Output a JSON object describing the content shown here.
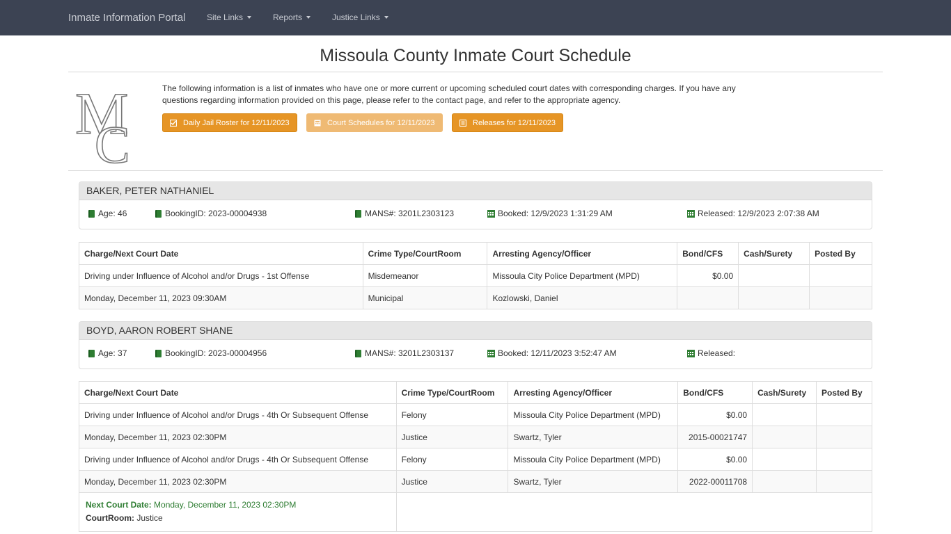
{
  "navbar": {
    "brand": "Inmate Information Portal",
    "menus": [
      "Site Links",
      "Reports",
      "Justice Links"
    ]
  },
  "page": {
    "title": "Missoula County Inmate Court Schedule",
    "intro": "The following information is a list of inmates who have one or more current or upcoming scheduled court dates with corresponding charges. If you have any questions regarding information provided on this page, please refer to the contact page, and refer to the appropriate agency.",
    "buttons": {
      "roster": "Daily Jail Roster for 12/11/2023",
      "court": "Court Schedules for 12/11/2023",
      "releases": "Releases for 12/11/2023"
    },
    "logo_text": "MC"
  },
  "columns1": [
    "Charge/Next Court Date",
    "Crime Type/CourtRoom",
    "Arresting Agency/Officer",
    "Bond/CFS",
    "Cash/Surety",
    "Posted By"
  ],
  "inmates": [
    {
      "name": "BAKER, PETER NATHANIEL",
      "age": "Age: 46",
      "booking_id": "BookingID: 2023-00004938",
      "mans": "MANS#: 3201L2303123",
      "booked": "Booked: 12/9/2023 1:31:29 AM",
      "released": "Released: 12/9/2023 2:07:38 AM",
      "rows": [
        [
          "Driving under Influence of Alcohol and/or Drugs - 1st Offense",
          "Misdemeanor",
          "Missoula City Police Department (MPD)",
          "$0.00",
          "",
          ""
        ],
        [
          "Monday, December 11, 2023 09:30AM",
          "Municipal",
          "Kozlowski, Daniel",
          "",
          "",
          ""
        ]
      ]
    },
    {
      "name": "BOYD, AARON ROBERT SHANE",
      "age": "Age: 37",
      "booking_id": "BookingID: 2023-00004956",
      "mans": "MANS#: 3201L2303137",
      "booked": "Booked: 12/11/2023 3:52:47 AM",
      "released": "Released:",
      "rows": [
        [
          "Driving under Influence of Alcohol and/or Drugs - 4th Or Subsequent Offense",
          "Felony",
          "Missoula City Police Department (MPD)",
          "$0.00",
          "",
          ""
        ],
        [
          "Monday, December 11, 2023 02:30PM",
          "Justice",
          "Swartz, Tyler",
          "2015-00021747",
          "",
          ""
        ],
        [
          "Driving under Influence of Alcohol and/or Drugs - 4th Or Subsequent Offense",
          "Felony",
          "Missoula City Police Department (MPD)",
          "$0.00",
          "",
          ""
        ],
        [
          "Monday, December 11, 2023 02:30PM",
          "Justice",
          "Swartz, Tyler",
          "2022-00011708",
          "",
          ""
        ]
      ],
      "next_court": {
        "label": "Next Court Date:",
        "value": "Monday, December 11, 2023 02:30PM",
        "room_label": "CourtRoom:",
        "room_value": "Justice"
      }
    }
  ],
  "colors": {
    "navbar": "#3c4353",
    "button": "#e69526",
    "button_disabled": "#efba74",
    "icon_green": "#2e7d32"
  }
}
